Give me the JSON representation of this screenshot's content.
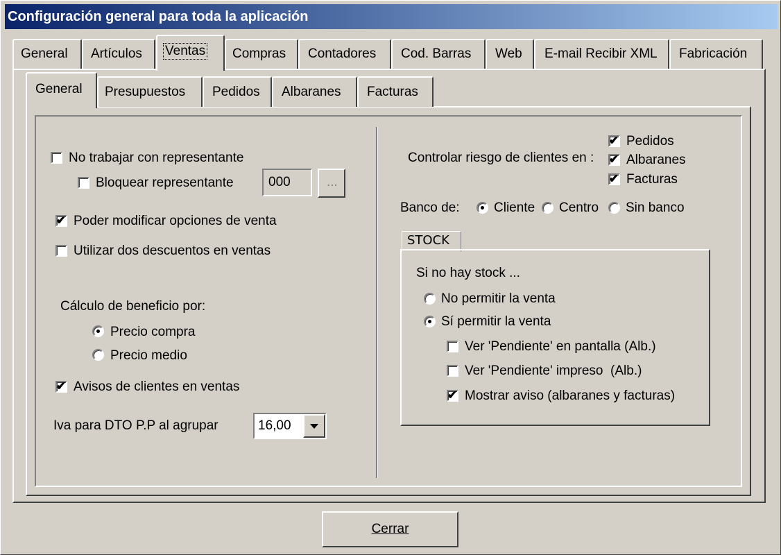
{
  "window": {
    "title": "Configuración general para toda la aplicación"
  },
  "main_tabs": [
    {
      "label": "General"
    },
    {
      "label": "Artículos"
    },
    {
      "label": "Ventas",
      "active": true
    },
    {
      "label": "Compras"
    },
    {
      "label": "Contadores"
    },
    {
      "label": "Cod. Barras"
    },
    {
      "label": "Web"
    },
    {
      "label": "E-mail Recibir XML"
    },
    {
      "label": "Fabricación"
    }
  ],
  "sub_tabs": [
    {
      "label": "General",
      "active": true
    },
    {
      "label": "Presupuestos"
    },
    {
      "label": "Pedidos"
    },
    {
      "label": "Albaranes"
    },
    {
      "label": "Facturas"
    }
  ],
  "left": {
    "no_representante": {
      "label": "No trabajar con representante",
      "checked": false
    },
    "bloquear_representante": {
      "label": "Bloquear representante",
      "checked": false,
      "code": "000",
      "browse": "..."
    },
    "modificar_opciones": {
      "label": "Poder modificar opciones de venta",
      "checked": true
    },
    "dos_descuentos": {
      "label": "Utilizar dos descuentos en ventas",
      "checked": false
    },
    "beneficio_heading": "Cálculo de beneficio por:",
    "precio_compra": {
      "label": "Precio compra",
      "selected": true
    },
    "precio_medio": {
      "label": "Precio medio",
      "selected": false
    },
    "avisos_clientes": {
      "label": "Avisos de clientes en ventas",
      "checked": true
    },
    "iva_label": "Iva para DTO P.P al agrupar",
    "iva_value": "16,00"
  },
  "right": {
    "riesgo_label": "Controlar riesgo de clientes en :",
    "riesgo_pedidos": {
      "label": "Pedidos",
      "checked": true
    },
    "riesgo_albaranes": {
      "label": "Albaranes",
      "checked": true
    },
    "riesgo_facturas": {
      "label": "Facturas",
      "checked": true
    },
    "banco_label": "Banco de:",
    "banco_cliente": {
      "label": "Cliente",
      "selected": true
    },
    "banco_centro": {
      "label": "Centro",
      "selected": false
    },
    "banco_sin": {
      "label": "Sin banco",
      "selected": false
    },
    "stock": {
      "title": "STOCK",
      "heading": "Si no hay stock ...",
      "no_permitir": {
        "label": "No permitir la venta",
        "selected": false
      },
      "si_permitir": {
        "label": "Sí permitir la venta",
        "selected": true
      },
      "pendiente_pantalla": {
        "label": "Ver 'Pendiente' en pantalla (Alb.)",
        "checked": false
      },
      "pendiente_impreso": {
        "label": "Ver 'Pendiente' impreso  (Alb.)",
        "checked": false
      },
      "mostrar_aviso": {
        "label": "Mostrar aviso (albaranes y facturas)",
        "checked": true
      }
    }
  },
  "footer": {
    "close_label": "Cerrar"
  }
}
